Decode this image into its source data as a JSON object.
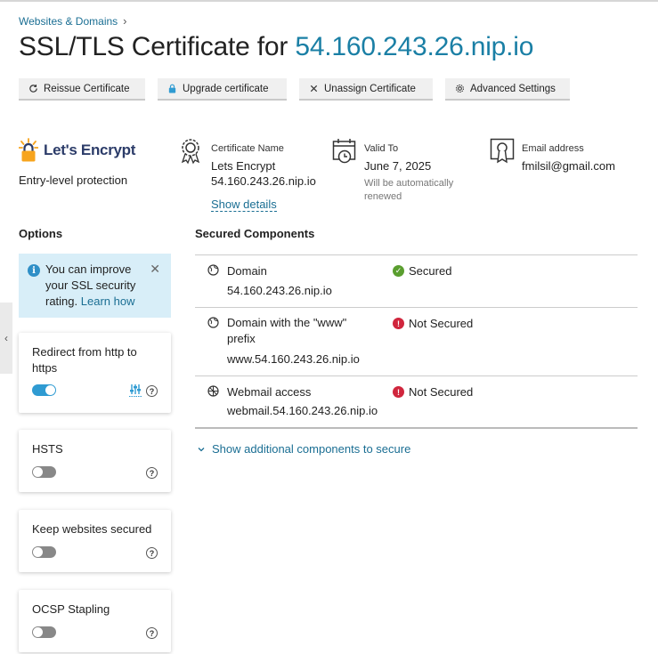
{
  "breadcrumb": {
    "item": "Websites & Domains",
    "separator": "›"
  },
  "page": {
    "title_prefix": "SSL/TLS Certificate for ",
    "title_host": "54.160.243.26.nip.io"
  },
  "toolbar": {
    "reissue": "Reissue Certificate",
    "upgrade": "Upgrade certificate",
    "unassign": "Unassign Certificate",
    "advanced": "Advanced Settings"
  },
  "provider": {
    "logo_text": "Let's Encrypt",
    "subtitle": "Entry-level protection"
  },
  "certificate": {
    "name_label": "Certificate Name",
    "name_line1": "Lets Encrypt",
    "name_line2": "54.160.243.26.nip.io",
    "show_details": "Show details",
    "valid_label": "Valid To",
    "valid_date": "June 7, 2025",
    "valid_note_1": "Will be automatically",
    "valid_note_2": "renewed",
    "email_label": "Email address",
    "email_value": "fmilsil@gmail.com"
  },
  "options": {
    "title": "Options",
    "hint_text": "You can improve your SSL security rating.",
    "hint_link": "Learn how",
    "hint_close": "✕",
    "cards": [
      {
        "title": "Redirect from http to https",
        "enabled": true
      },
      {
        "title": "HSTS",
        "enabled": false
      },
      {
        "title": "Keep websites secured",
        "enabled": false
      },
      {
        "title": "OCSP Stapling",
        "enabled": false
      }
    ],
    "help_glyph": "?"
  },
  "components": {
    "title": "Secured Components",
    "rows": [
      {
        "name": "Domain",
        "domain": "54.160.243.26.nip.io",
        "status": "Secured",
        "icon": "globe-icon"
      },
      {
        "name_line1": "Domain with the \"www\"",
        "name_line2": "prefix",
        "domain": "www.54.160.243.26.nip.io",
        "status": "Not Secured",
        "icon": "globe-icon"
      },
      {
        "name": "Webmail access",
        "domain": "webmail.54.160.243.26.nip.io",
        "status": "Not Secured",
        "icon": "webmail-globe-icon"
      }
    ],
    "show_more": "Show additional components to secure"
  },
  "colors": {
    "accent": "#1a7fa5",
    "ok": "#5a9e2f",
    "error": "#d0263d",
    "hint_bg": "#d8eef8"
  }
}
